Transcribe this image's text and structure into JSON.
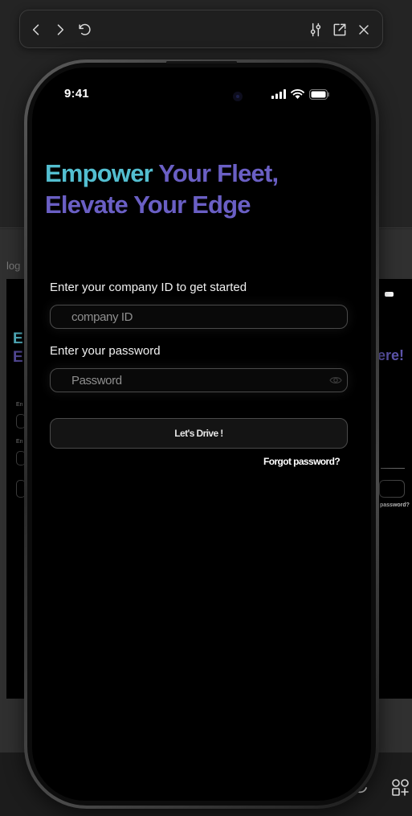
{
  "toolbar": {
    "back_icon": "chevron-left-icon",
    "forward_icon": "chevron-right-icon",
    "reload_icon": "undo-icon",
    "adjust_icon": "sliders-icon",
    "open_external_icon": "external-link-icon",
    "close_icon": "close-icon"
  },
  "background": {
    "frame_label": "log",
    "ghost_headline_line1": "E",
    "ghost_headline_line2": "E",
    "ghost_right_text": "ere!",
    "ghost_forgot_text": "password?",
    "ghost_small_1": "En",
    "ghost_small_2": "En"
  },
  "status_bar": {
    "time": "9:41",
    "icons": [
      "cellular-signal-icon",
      "wifi-icon",
      "battery-icon"
    ]
  },
  "login": {
    "headline_accent": "Empower",
    "headline_rest_line1": " Your Fleet,",
    "headline_line2": "Elevate Your Edge",
    "company_id_label": "Enter your company ID to get started",
    "company_id_placeholder": "company ID",
    "company_id_value": "",
    "password_label": "Enter your password",
    "password_placeholder": "Password",
    "password_value": "",
    "submit_label": "Let's Drive !",
    "forgot_label": "Forgot password?"
  },
  "colors": {
    "accent_teal": "#53bed0",
    "accent_purple": "#6a5fc4",
    "screen_bg": "#000000"
  }
}
